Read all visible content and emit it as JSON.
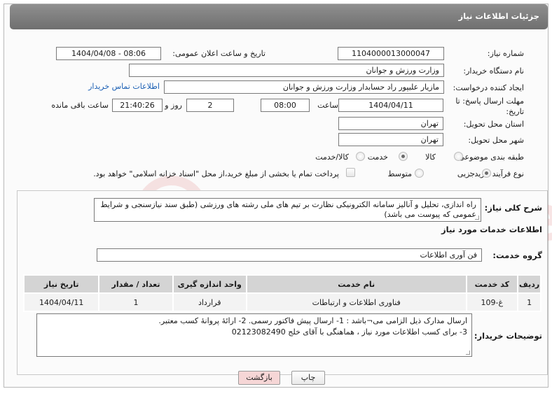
{
  "header": {
    "title": "جزئیات اطلاعات نیاز"
  },
  "form": {
    "need_number": {
      "label": "شماره نیاز:",
      "value": "1104000013000047"
    },
    "announce_datetime": {
      "label": "تاریخ و ساعت اعلان عمومی:",
      "value": "1404/04/08 - 08:06"
    },
    "buyer_org": {
      "label": "نام دستگاه خریدار:",
      "value": "وزارت ورزش و جوانان"
    },
    "requester": {
      "label": "ایجاد کننده درخواست:",
      "value": "مازیار  علیپور راد حسابدار وزارت ورزش و جوانان",
      "contact_link": "اطلاعات تماس خریدار"
    },
    "deadline": {
      "label": "مهلت ارسال پاسخ: تا تاریخ:",
      "date": "1404/04/11",
      "time_label": "ساعت",
      "time": "08:00",
      "days": "2",
      "days_label": "روز و",
      "remaining_time": "21:40:26",
      "remaining_label": "ساعت باقی مانده"
    },
    "province": {
      "label": "استان محل تحویل:",
      "value": "تهران"
    },
    "city": {
      "label": "شهر محل تحویل:",
      "value": "تهران"
    },
    "category": {
      "label": "طبقه بندی موضوعی:",
      "options": [
        "کالا",
        "خدمت",
        "کالا/خدمت"
      ],
      "selected": "خدمت"
    },
    "process": {
      "label": "نوع فرآیند خرید :",
      "options": [
        "جزیی",
        "متوسط"
      ],
      "selected": "جزیی",
      "payment_note": "پرداخت تمام یا بخشی از مبلغ خرید،از محل \"اسناد خزانه اسلامی\" خواهد بود."
    }
  },
  "description": {
    "label": "شرح کلی نیاز:",
    "text": "راه اندازی، تحلیل و آنالیز سامانه الکترونیکی نظارت بر تیم های ملی رشته های ورزشی (طبق سند نیازسنجی و شرایط عمومی که پیوست می باشد)"
  },
  "services": {
    "section_title": "اطلاعات خدمات مورد نیاز",
    "group_label": "گروه خدمت:",
    "group_value": "فن آوری اطلاعات",
    "table": {
      "headers": [
        "ردیف",
        "کد خدمت",
        "نام خدمت",
        "واحد اندازه گیری",
        "تعداد / مقدار",
        "تاریخ نیاز"
      ],
      "rows": [
        [
          "1",
          "غ-109",
          "فناوری اطلاعات و ارتباطات",
          "قرارداد",
          "1",
          "1404/04/11"
        ]
      ]
    }
  },
  "buyer_notes": {
    "label": "توضیحات خریدار:",
    "line1": "ارسال مدارک ذیل الزامی می¬باشد : 1- ارسال پیش فاکتور رسمی. 2- ارائۀ پروانۀ کسب معتبر.",
    "line2": "3- برای کسب اطلاعات مورد نیاز ، هماهنگی با آقای خلج 02123082490"
  },
  "buttons": {
    "print": "چاپ",
    "back": "بازگشت"
  },
  "colors": {
    "title_bar": "#7f7f7f",
    "link": "#1a5fb4",
    "back_button": "#f6d6d6",
    "table_header": "#d4d4d4"
  }
}
